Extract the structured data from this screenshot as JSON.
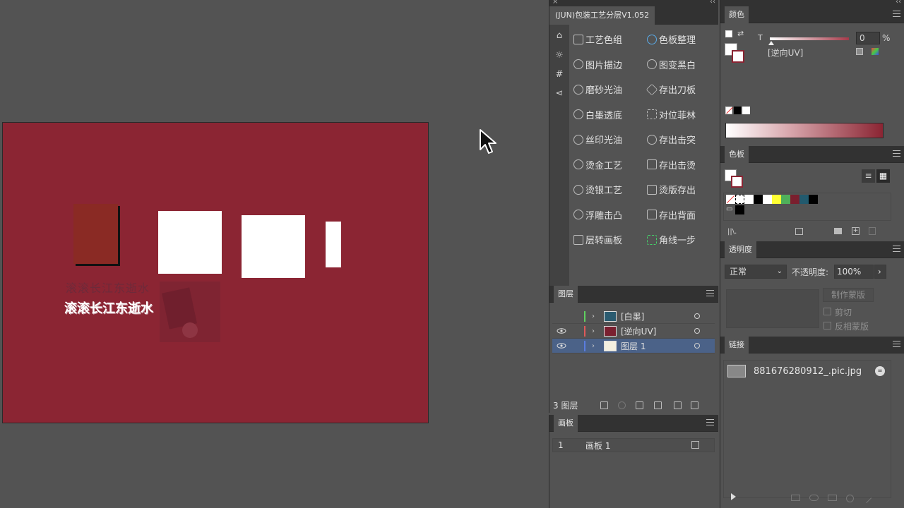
{
  "canvas": {
    "text_line1": "滚滚长江东逝水",
    "text_line2": "滚滚长江东逝水"
  },
  "plugin": {
    "tab_label": "(JUN)包装工艺分层V1.052",
    "buttons": [
      {
        "label": "工艺色组",
        "icon": "calendar-icon"
      },
      {
        "label": "色板整理",
        "icon": "thumbs-up-icon"
      },
      {
        "label": "图片描边",
        "icon": "sun-icon"
      },
      {
        "label": "图变黑白",
        "icon": "rotate-icon"
      },
      {
        "label": "磨砂光油",
        "icon": "plus-circle-icon"
      },
      {
        "label": "存出刀板",
        "icon": "hexagon-icon"
      },
      {
        "label": "白墨透底",
        "icon": "info-circle-icon"
      },
      {
        "label": "对位菲林",
        "icon": "frame-icon"
      },
      {
        "label": "丝印光油",
        "icon": "sparkle-icon"
      },
      {
        "label": "存出击突",
        "icon": "alert-circle-icon"
      },
      {
        "label": "烫金工艺",
        "icon": "check-circle-icon"
      },
      {
        "label": "存出击烫",
        "icon": "check-square-icon"
      },
      {
        "label": "烫银工艺",
        "icon": "compass-icon"
      },
      {
        "label": "烫版存出",
        "icon": "plus-square-icon"
      },
      {
        "label": "浮雕击凸",
        "icon": "help-circle-icon"
      },
      {
        "label": "存出背面",
        "icon": "square-icon"
      },
      {
        "label": "层转画板",
        "icon": "document-icon"
      },
      {
        "label": "角线一步",
        "icon": "crop-marks-icon"
      }
    ]
  },
  "layers": {
    "title": "图层",
    "rows": [
      {
        "name": "[白墨]",
        "color": "#5fd15f",
        "visible": false
      },
      {
        "name": "[逆向UV]",
        "color": "#e05a5a",
        "visible": true
      },
      {
        "name": "图层 1",
        "color": "#5a7de0",
        "visible": true
      }
    ],
    "count_label": "3 图层"
  },
  "artboards": {
    "title": "画板",
    "rows": [
      {
        "index": "1",
        "name": "画板 1"
      }
    ]
  },
  "color": {
    "title": "颜色",
    "channel": "T",
    "value": "0",
    "unit": "%",
    "swatch_name": "[逆向UV]"
  },
  "swatches": {
    "title": "色板"
  },
  "transparency": {
    "title": "透明度",
    "blend_mode": "正常",
    "opacity_label": "不透明度:",
    "opacity_value": "100%",
    "make_mask": "制作蒙版",
    "clip": "剪切",
    "invert_mask": "反相蒙版"
  },
  "links": {
    "title": "链接",
    "items": [
      {
        "name": "881676280912_.pic.jpg"
      }
    ]
  },
  "colors": {
    "artboard": "#8b2533",
    "panel": "#535353",
    "panel_dark": "#323232",
    "selection": "#4b6288"
  }
}
